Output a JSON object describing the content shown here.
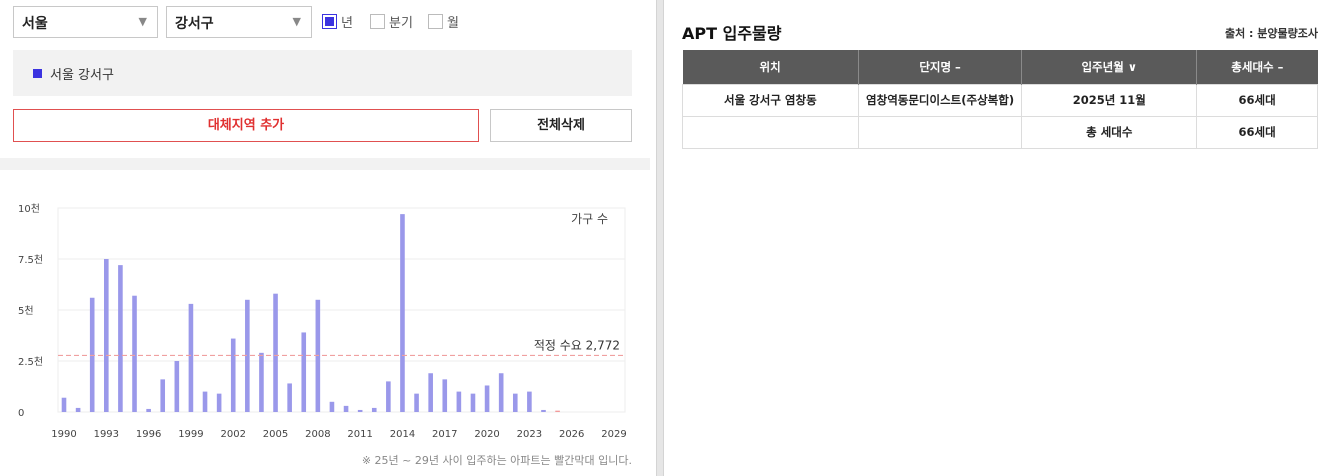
{
  "filters": {
    "city": "서울",
    "district": "강서구",
    "periods": [
      {
        "label": "년",
        "checked": true
      },
      {
        "label": "분기",
        "checked": false
      },
      {
        "label": "월",
        "checked": false
      }
    ]
  },
  "region_list": [
    {
      "label": "서울 강서구",
      "color": "#3b33e0"
    }
  ],
  "buttons": {
    "add_region": "대체지역 추가",
    "clear_all": "전체삭제"
  },
  "chart_data": {
    "type": "bar",
    "series_label": "가구 수",
    "x_tick_labels": [
      "1990",
      "1993",
      "1996",
      "1999",
      "2002",
      "2005",
      "2008",
      "2011",
      "2014",
      "2017",
      "2020",
      "2023",
      "2026",
      "2029"
    ],
    "y_tick_labels": [
      "0",
      "2.5천",
      "5천",
      "7.5천",
      "10천"
    ],
    "ylim": [
      0,
      10000
    ],
    "xlim": [
      1990,
      2029
    ],
    "bar_color": "#9a98ea",
    "highlight_color": "#f29a9a",
    "bars": [
      {
        "year": 1990,
        "value": 700
      },
      {
        "year": 1991,
        "value": 200
      },
      {
        "year": 1992,
        "value": 5600
      },
      {
        "year": 1993,
        "value": 7500
      },
      {
        "year": 1994,
        "value": 7200
      },
      {
        "year": 1995,
        "value": 5700
      },
      {
        "year": 1996,
        "value": 150
      },
      {
        "year": 1997,
        "value": 1600
      },
      {
        "year": 1998,
        "value": 2500
      },
      {
        "year": 1999,
        "value": 5300
      },
      {
        "year": 2000,
        "value": 1000
      },
      {
        "year": 2001,
        "value": 900
      },
      {
        "year": 2002,
        "value": 3600
      },
      {
        "year": 2003,
        "value": 5500
      },
      {
        "year": 2004,
        "value": 2900
      },
      {
        "year": 2005,
        "value": 5800
      },
      {
        "year": 2006,
        "value": 1400
      },
      {
        "year": 2007,
        "value": 3900
      },
      {
        "year": 2008,
        "value": 5500
      },
      {
        "year": 2009,
        "value": 500
      },
      {
        "year": 2010,
        "value": 300
      },
      {
        "year": 2011,
        "value": 100
      },
      {
        "year": 2012,
        "value": 200
      },
      {
        "year": 2013,
        "value": 1500
      },
      {
        "year": 2014,
        "value": 9700
      },
      {
        "year": 2015,
        "value": 900
      },
      {
        "year": 2016,
        "value": 1900
      },
      {
        "year": 2017,
        "value": 1600
      },
      {
        "year": 2018,
        "value": 1000
      },
      {
        "year": 2019,
        "value": 900
      },
      {
        "year": 2020,
        "value": 1300
      },
      {
        "year": 2021,
        "value": 1900
      },
      {
        "year": 2022,
        "value": 900
      },
      {
        "year": 2023,
        "value": 1000
      },
      {
        "year": 2024,
        "value": 100
      },
      {
        "year": 2025,
        "value": 66
      }
    ],
    "highlight_years": [
      2025,
      2026,
      2027,
      2028,
      2029
    ],
    "demand_line": {
      "value": 2772,
      "label": "적정 수요 2,772",
      "color": "#f0a0a0"
    },
    "footnote": "※ 25년 ~ 29년 사이 입주하는 아파트는 빨간막대 입니다."
  },
  "supply_table": {
    "title": "APT 입주물량",
    "source": "출처 : 분양물량조사",
    "columns": [
      "위치",
      "단지명 –",
      "입주년월 ∨",
      "총세대수 –"
    ],
    "rows": [
      [
        "서울 강서구 염창동",
        "염창역동문디이스트(주상복합)",
        "2025년 11월",
        "66세대"
      ],
      [
        "",
        "",
        "총 세대수",
        "66세대"
      ]
    ]
  }
}
